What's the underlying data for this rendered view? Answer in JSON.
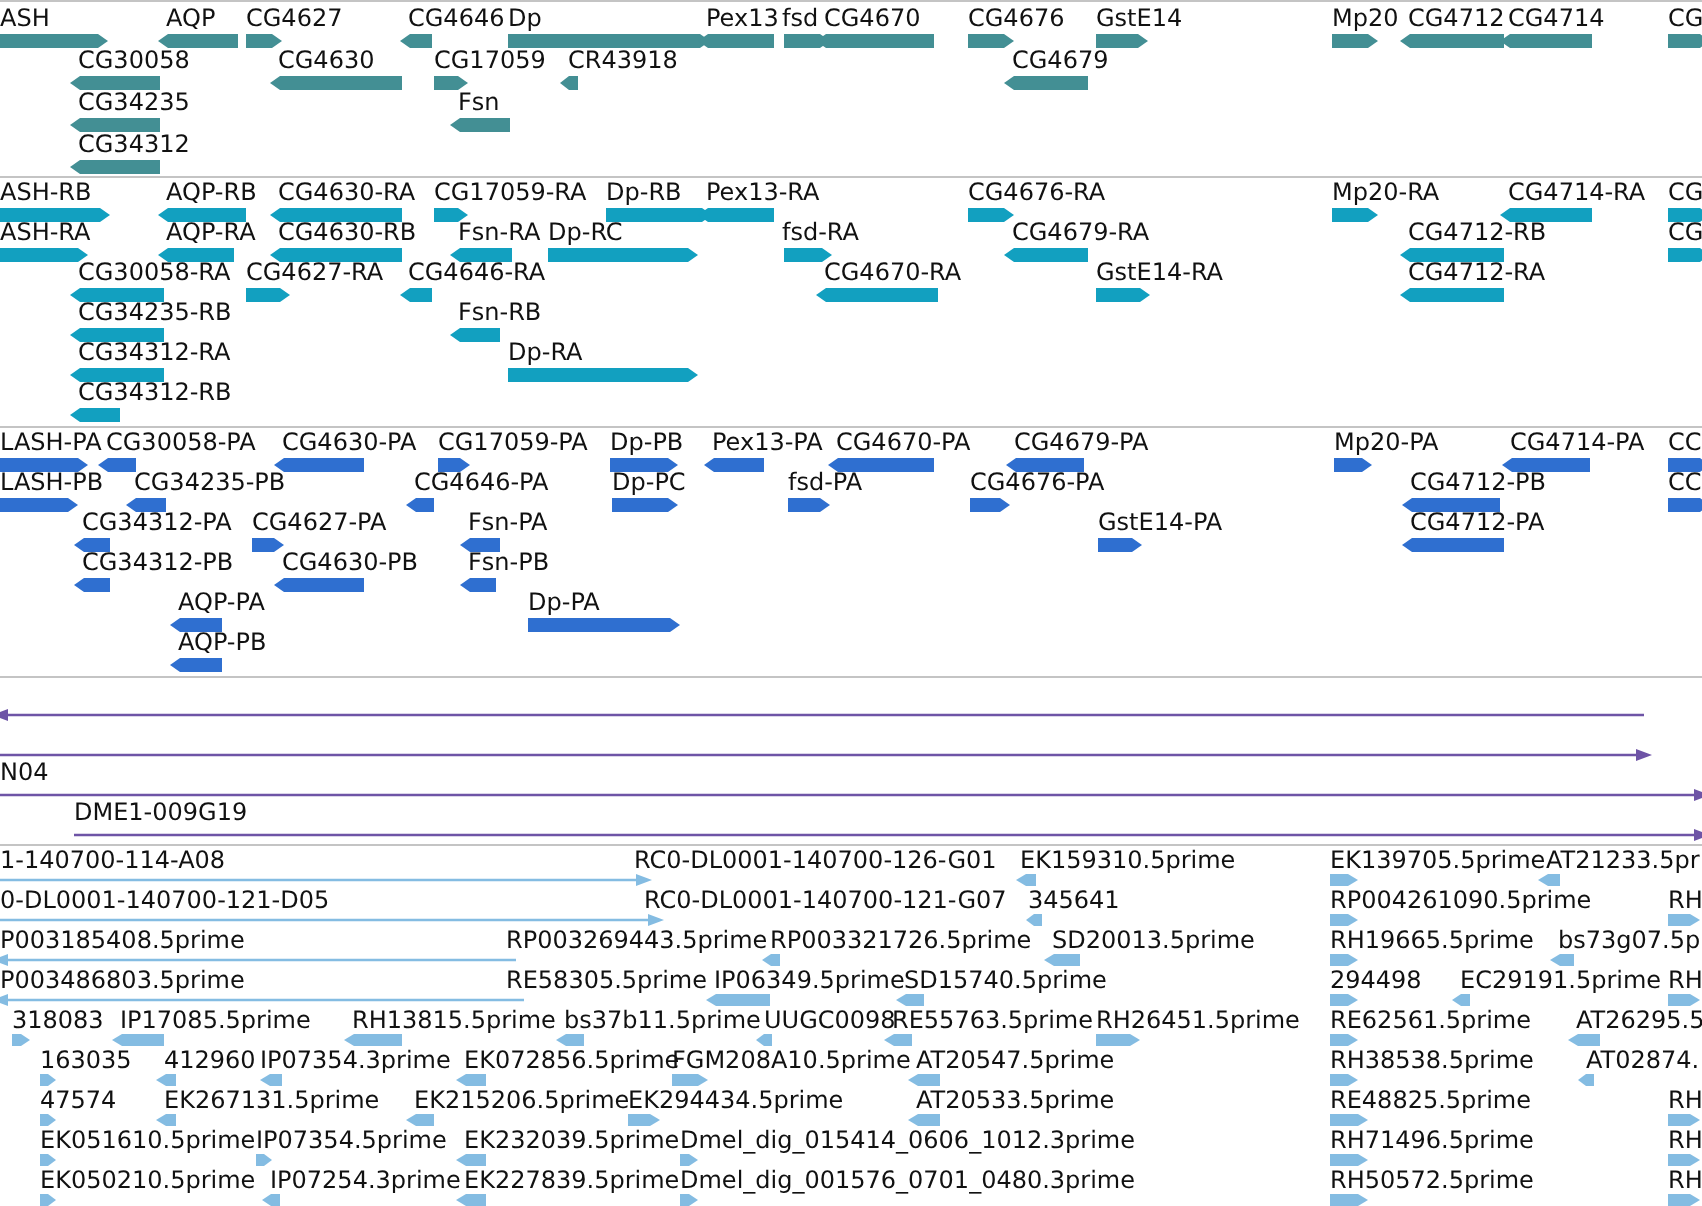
{
  "tracks": [
    {
      "kind": "gene",
      "features": [
        {
          "label": "ASH",
          "reverse": false
        },
        {
          "label": "AQP",
          "reverse": true
        },
        {
          "label": "CG4627",
          "reverse": false
        },
        {
          "label": "CG4646",
          "reverse": true
        },
        {
          "label": "Dp",
          "reverse": false
        },
        {
          "label": "Pex13",
          "reverse": true
        },
        {
          "label": "fsd",
          "reverse": false
        },
        {
          "label": "CG4670",
          "reverse": true
        },
        {
          "label": "CG4676",
          "reverse": false
        },
        {
          "label": "GstE14",
          "reverse": false
        },
        {
          "label": "Mp20",
          "reverse": false
        },
        {
          "label": "CG4712",
          "reverse": true
        },
        {
          "label": "CG4714",
          "reverse": true
        },
        {
          "label": "CG",
          "reverse": false
        },
        {
          "label": "CG30058",
          "reverse": true
        },
        {
          "label": "CG4630",
          "reverse": true
        },
        {
          "label": "CG17059",
          "reverse": false
        },
        {
          "label": "CR43918",
          "reverse": true
        },
        {
          "label": "CG4679",
          "reverse": true
        },
        {
          "label": "CG34235",
          "reverse": true
        },
        {
          "label": "Fsn",
          "reverse": true
        },
        {
          "label": "CG34312",
          "reverse": true
        }
      ]
    },
    {
      "kind": "transcript",
      "features": [
        {
          "label": "ASH-RB",
          "reverse": false
        },
        {
          "label": "AQP-RB",
          "reverse": true
        },
        {
          "label": "CG4630-RA",
          "reverse": true
        },
        {
          "label": "CG17059-RA",
          "reverse": false
        },
        {
          "label": "Dp-RB",
          "reverse": false
        },
        {
          "label": "Pex13-RA",
          "reverse": true
        },
        {
          "label": "CG4676-RA",
          "reverse": false
        },
        {
          "label": "Mp20-RA",
          "reverse": false
        },
        {
          "label": "CG4714-RA",
          "reverse": true
        },
        {
          "label": "CG",
          "reverse": false
        },
        {
          "label": "ASH-RA",
          "reverse": false
        },
        {
          "label": "AQP-RA",
          "reverse": true
        },
        {
          "label": "CG4630-RB",
          "reverse": true
        },
        {
          "label": "Fsn-RA",
          "reverse": true
        },
        {
          "label": "Dp-RC",
          "reverse": false
        },
        {
          "label": "fsd-RA",
          "reverse": false
        },
        {
          "label": "CG4679-RA",
          "reverse": true
        },
        {
          "label": "CG4712-RB",
          "reverse": true
        },
        {
          "label": "CG",
          "reverse": false
        },
        {
          "label": "CG30058-RA",
          "reverse": true
        },
        {
          "label": "CG4627-RA",
          "reverse": false
        },
        {
          "label": "CG4646-RA",
          "reverse": true
        },
        {
          "label": "CG4670-RA",
          "reverse": true
        },
        {
          "label": "GstE14-RA",
          "reverse": false
        },
        {
          "label": "CG4712-RA",
          "reverse": true
        },
        {
          "label": "CG34235-RB",
          "reverse": true
        },
        {
          "label": "Fsn-RB",
          "reverse": true
        },
        {
          "label": "CG34312-RA",
          "reverse": true
        },
        {
          "label": "Dp-RA",
          "reverse": false
        },
        {
          "label": "CG34312-RB",
          "reverse": true
        }
      ]
    },
    {
      "kind": "protein",
      "features": [
        {
          "label": "LASH-PA",
          "reverse": false
        },
        {
          "label": "CG30058-PA",
          "reverse": true
        },
        {
          "label": "CG4630-PA",
          "reverse": true
        },
        {
          "label": "CG17059-PA",
          "reverse": false
        },
        {
          "label": "Dp-PB",
          "reverse": false
        },
        {
          "label": "Pex13-PA",
          "reverse": true
        },
        {
          "label": "CG4670-PA",
          "reverse": true
        },
        {
          "label": "CG4679-PA",
          "reverse": true
        },
        {
          "label": "Mp20-PA",
          "reverse": false
        },
        {
          "label": "CG4714-PA",
          "reverse": true
        },
        {
          "label": "CC",
          "reverse": false
        },
        {
          "label": "LASH-PB",
          "reverse": false
        },
        {
          "label": "CG34235-PB",
          "reverse": true
        },
        {
          "label": "CG4646-PA",
          "reverse": true
        },
        {
          "label": "Dp-PC",
          "reverse": false
        },
        {
          "label": "fsd-PA",
          "reverse": false
        },
        {
          "label": "CG4676-PA",
          "reverse": false
        },
        {
          "label": "CG4712-PB",
          "reverse": true
        },
        {
          "label": "CC",
          "reverse": false
        },
        {
          "label": "CG34312-PA",
          "reverse": true
        },
        {
          "label": "CG4627-PA",
          "reverse": false
        },
        {
          "label": "Fsn-PA",
          "reverse": true
        },
        {
          "label": "GstE14-PA",
          "reverse": false
        },
        {
          "label": "CG4712-PA",
          "reverse": true
        },
        {
          "label": "CG34312-PB",
          "reverse": true
        },
        {
          "label": "CG4630-PB",
          "reverse": true
        },
        {
          "label": "Fsn-PB",
          "reverse": true
        },
        {
          "label": "AQP-PA",
          "reverse": true
        },
        {
          "label": "Dp-PA",
          "reverse": false
        },
        {
          "label": "AQP-PB",
          "reverse": true
        }
      ]
    },
    {
      "kind": "alignment",
      "features": [
        {
          "reverse": true
        },
        {
          "reverse": false
        },
        {
          "label": "N04",
          "reverse": false
        },
        {
          "label": "DME1-009G19",
          "reverse": false
        }
      ]
    },
    {
      "kind": "est",
      "features": [
        {
          "label": "1-140700-114-A08",
          "reverse": false
        },
        {
          "label": "RC0-DL0001-140700-126-G01"
        },
        {
          "label": "EK159310.5prime",
          "reverse": true
        },
        {
          "label": "EK139705.5prime",
          "reverse": false
        },
        {
          "label": "AT21233.5pr",
          "reverse": true
        },
        {
          "label": "0-DL0001-140700-121-D05",
          "reverse": false
        },
        {
          "label": "RC0-DL0001-140700-121-G07"
        },
        {
          "label": "345641",
          "reverse": true
        },
        {
          "label": "RP004261090.5prime",
          "reverse": false
        },
        {
          "label": "RH",
          "reverse": false
        },
        {
          "label": "P003185408.5prime",
          "reverse": true
        },
        {
          "label": "RP003269443.5prime"
        },
        {
          "label": "RP003321726.5prime",
          "reverse": true
        },
        {
          "label": "SD20013.5prime",
          "reverse": true
        },
        {
          "label": "RH19665.5prime",
          "reverse": false
        },
        {
          "label": "bs73g07.5p",
          "reverse": true
        },
        {
          "label": "P003486803.5prime",
          "reverse": true
        },
        {
          "label": "RE58305.5prime"
        },
        {
          "label": "IP06349.5prime",
          "reverse": true
        },
        {
          "label": "SD15740.5prime",
          "reverse": true
        },
        {
          "label": "294498",
          "reverse": false
        },
        {
          "label": "EC29191.5prime",
          "reverse": true
        },
        {
          "label": "RH",
          "reverse": false
        },
        {
          "label": "318083",
          "reverse": false
        },
        {
          "label": "IP17085.5prime",
          "reverse": true
        },
        {
          "label": "RH13815.5prime",
          "reverse": true
        },
        {
          "label": "bs37b11.5prime",
          "reverse": true
        },
        {
          "label": "UUGC0098",
          "reverse": true
        },
        {
          "label": "RE55763.5prime",
          "reverse": true
        },
        {
          "label": "RH26451.5prime",
          "reverse": false
        },
        {
          "label": "RE62561.5prime",
          "reverse": false
        },
        {
          "label": "AT26295.5",
          "reverse": true
        },
        {
          "label": "163035",
          "reverse": false
        },
        {
          "label": "412960",
          "reverse": true
        },
        {
          "label": "IP07354.3prime",
          "reverse": true
        },
        {
          "label": "EK072856.5prime",
          "reverse": true
        },
        {
          "label": "FGM208A10.5prime",
          "reverse": false
        },
        {
          "label": "AT20547.5prime",
          "reverse": true
        },
        {
          "label": "RH38538.5prime",
          "reverse": false
        },
        {
          "label": "AT02874.",
          "reverse": true
        },
        {
          "label": "47574",
          "reverse": false
        },
        {
          "label": "EK267131.5prime",
          "reverse": true
        },
        {
          "label": "EK215206.5prime",
          "reverse": true
        },
        {
          "label": "EK294434.5prime",
          "reverse": false
        },
        {
          "label": "AT20533.5prime",
          "reverse": true
        },
        {
          "label": "RE48825.5prime",
          "reverse": false
        },
        {
          "label": "RH",
          "reverse": false
        },
        {
          "label": "EK051610.5prime",
          "reverse": false
        },
        {
          "label": "IP07354.5prime",
          "reverse": false
        },
        {
          "label": "EK232039.5prime",
          "reverse": true
        },
        {
          "label": "Dmel_dig_015414_0606_1012.3prime",
          "reverse": false
        },
        {
          "label": "RH71496.5prime",
          "reverse": false
        },
        {
          "label": "RH",
          "reverse": false
        },
        {
          "label": "EK050210.5prime",
          "reverse": false
        },
        {
          "label": "IP07254.3prime",
          "reverse": true
        },
        {
          "label": "EK227839.5prime",
          "reverse": true
        },
        {
          "label": "Dmel_dig_001576_0701_0480.3prime",
          "reverse": false
        },
        {
          "label": "RH50572.5prime",
          "reverse": false
        },
        {
          "label": "RH",
          "reverse": false
        }
      ]
    }
  ]
}
